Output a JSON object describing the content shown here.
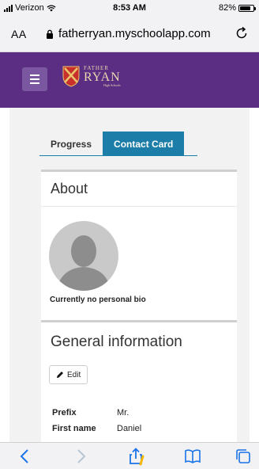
{
  "status_bar": {
    "carrier": "Verizon",
    "time": "8:53 AM",
    "battery": "82%"
  },
  "browser": {
    "text_size_label": "AA",
    "url": "fatherryan.myschoolapp.com"
  },
  "app_header": {
    "logo_line1": "FATHER",
    "logo_line2": "RYAN",
    "logo_line3": "High Schools"
  },
  "tabs": [
    {
      "label": "Progress",
      "active": false
    },
    {
      "label": "Contact Card",
      "active": true
    }
  ],
  "about": {
    "title": "About",
    "bio": "Currently no personal bio"
  },
  "general": {
    "title": "General information",
    "edit_label": "Edit",
    "fields": [
      {
        "label": "Prefix",
        "value": "Mr."
      },
      {
        "label": "First name",
        "value": "Daniel"
      }
    ]
  },
  "colors": {
    "header": "#5b2d83",
    "tab_active": "#1b7da8",
    "ios_blue": "#1a73e8"
  }
}
